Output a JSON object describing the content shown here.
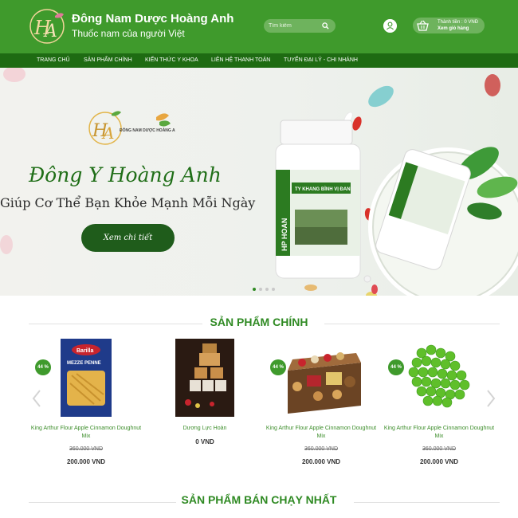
{
  "header": {
    "brand_name": "Đông Nam Dược Hoàng Anh",
    "tagline": "Thuốc nam của người Việt",
    "search_placeholder": "Tìm kiếm",
    "cart_total": "Thành tiền : 0 VNĐ",
    "cart_view": "Xem giỏ hàng",
    "brand_color": "#3f9a2c",
    "nav_color": "#1e6b12"
  },
  "nav": {
    "items": [
      {
        "label": "TRANG CHỦ"
      },
      {
        "label": "SẢN PHẨM CHÍNH"
      },
      {
        "label": "KIẾN THỨC Y KHOA"
      },
      {
        "label": "LIÊN HỆ THANH TOÁN"
      },
      {
        "label": "TUYỂN ĐẠI LÝ - CHI NHÁNH"
      }
    ]
  },
  "hero": {
    "title": "Đông Y Hoàng Anh",
    "subtitle": "Giúp Cơ Thể Bạn Khỏe Mạnh Mỗi Ngày",
    "button_label": "Xem chi tiết",
    "logo_text": "ĐÔNG NAM DƯỢC HOÀNG ANH",
    "product_label": "TY KHANG BÌNH VỊ ĐAN",
    "active_slide": 1,
    "slide_count": 4
  },
  "main_products": {
    "title": "SẢN PHẨM CHÍNH",
    "items": [
      {
        "name": "King Arthur Flour Apple Cinnamon Doughnut Mix",
        "old_price": "360.000 VND",
        "price": "200.000 VND",
        "badge": "44 %",
        "image": "pasta-box",
        "image_text": "MEZZE PENNE"
      },
      {
        "name": "Dương Lực Hoàn",
        "old_price": "",
        "price": "0 VND",
        "badge": "",
        "image": "herbal-bottles"
      },
      {
        "name": "King Arthur Flour Apple Cinnamon Doughnut Mix",
        "old_price": "360.000 VND",
        "price": "200.000 VND",
        "badge": "44 %",
        "image": "snack-basket"
      },
      {
        "name": "King Arthur Flour Apple Cinnamon Doughnut Mix",
        "old_price": "360.000 VND",
        "price": "200.000 VND",
        "badge": "44 %",
        "image": "green-peas"
      }
    ]
  },
  "bestsellers": {
    "title": "SẢN PHẨM BÁN CHẠY NHẤT"
  }
}
